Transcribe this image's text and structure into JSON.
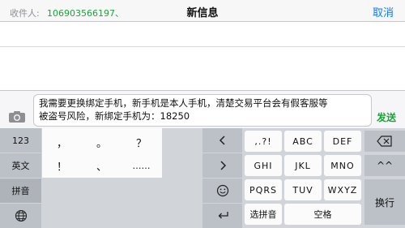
{
  "nav": {
    "title": "新信息",
    "cancel": "取消"
  },
  "recipient": {
    "label": "收件人:",
    "value": "106903566197、"
  },
  "message": {
    "line1": "我需要更换绑定手机，新手机是本人手机，清楚交易平台会有假客服等",
    "line2": "被盗号风险，新绑定手机为：18250",
    "send": "发送"
  },
  "keyboard": {
    "left_column": [
      "123",
      "英文",
      "拼音"
    ],
    "symbols_row1": [
      "，",
      "。",
      "？"
    ],
    "symbols_row2": [
      "！",
      "、",
      "……"
    ],
    "rows": [
      [
        ",.?!",
        "ABC",
        "DEF"
      ],
      [
        "GHI",
        "JKL",
        "MNO"
      ],
      [
        "PQRS",
        "TUV",
        "WXYZ"
      ]
    ],
    "bottom": {
      "pinyin_select": "选拼音",
      "space": "空格"
    },
    "return_key": "换行",
    "face_key": "^^"
  },
  "icons": [
    "camera-icon",
    "globe-icon",
    "chevron-left-icon",
    "chevron-right-icon",
    "emoji-icon",
    "return-arrow-icon",
    "delete-icon"
  ]
}
